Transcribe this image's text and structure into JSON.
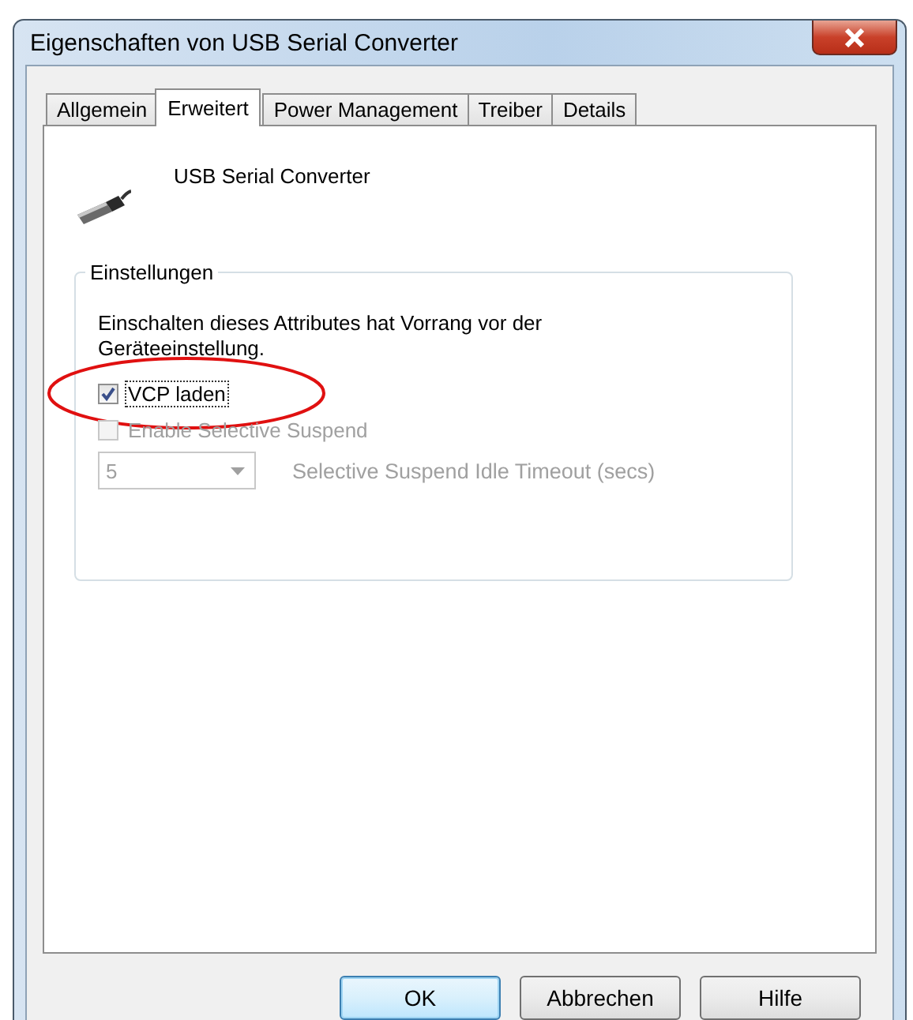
{
  "window": {
    "title": "Eigenschaften von USB Serial Converter"
  },
  "tabs": [
    {
      "label": "Allgemein",
      "selected": false
    },
    {
      "label": "Erweitert",
      "selected": true
    },
    {
      "label": "Power Management",
      "selected": false
    },
    {
      "label": "Treiber",
      "selected": false
    },
    {
      "label": "Details",
      "selected": false
    }
  ],
  "device": {
    "name": "USB Serial Converter"
  },
  "settings": {
    "title": "Einstellungen",
    "description": "Einschalten dieses Attributes hat Vorrang vor der Geräteeinstellung.",
    "checkboxes": [
      {
        "label": "VCP laden",
        "checked": true,
        "disabled": false,
        "focused": true,
        "highlighted": true
      },
      {
        "label": "Enable Selective Suspend",
        "checked": false,
        "disabled": true,
        "focused": false,
        "highlighted": false
      }
    ],
    "timeout": {
      "value": "5",
      "label": "Selective Suspend Idle Timeout (secs)",
      "disabled": true
    }
  },
  "buttons": [
    {
      "label": "OK",
      "default": true
    },
    {
      "label": "Abbrechen",
      "default": false
    },
    {
      "label": "Hilfe",
      "default": false
    }
  ]
}
